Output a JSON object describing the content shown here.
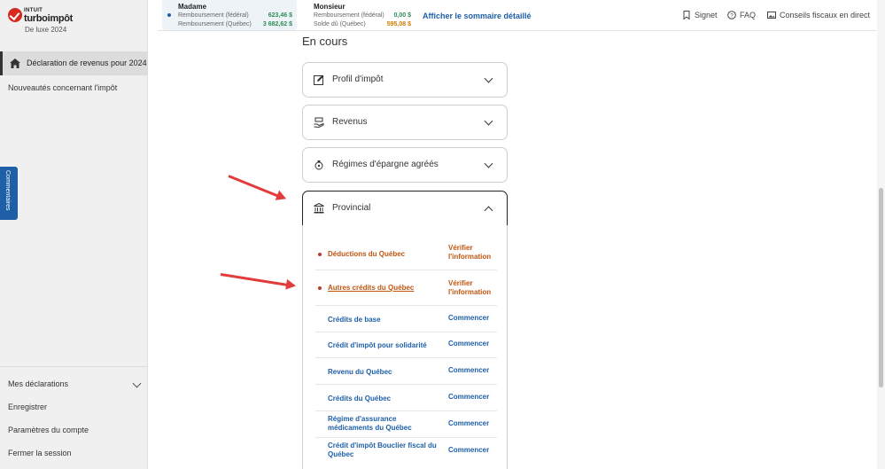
{
  "brand": {
    "intuit": "INTUIT",
    "name": "turboimpôt",
    "edition": "De luxe 2024"
  },
  "sidebar": {
    "active_item": "Déclaration de revenus pour 2024",
    "news_item": "Nouveautés concernant l'impôt",
    "comments_tab": "Commentaires",
    "bottom_items": [
      "Mes déclarations",
      "Enregistrer",
      "Paramètres du compte",
      "Fermer la session"
    ]
  },
  "topbar": {
    "madame": {
      "name": "Madame",
      "rows": [
        {
          "label": "Remboursement (fédéral)",
          "value": "623,46  $"
        },
        {
          "label": "Remboursement (Québec)",
          "value": "3  682,62  $"
        }
      ]
    },
    "monsieur": {
      "name": "Monsieur",
      "rows": [
        {
          "label": "Remboursement (fédéral)",
          "value": "0,00  $"
        },
        {
          "label": "Solde dû (Québec)",
          "value": "595,08  $"
        }
      ]
    },
    "summary_link": "Afficher le sommaire détaillé",
    "actions": [
      "Signet",
      "FAQ",
      "Conseils fiscaux en direct"
    ]
  },
  "main": {
    "section_title": "En cours",
    "accordions": [
      {
        "label": "Profil d'impôt",
        "icon": "edit-icon",
        "open": false
      },
      {
        "label": "Revenus",
        "icon": "money-hand-icon",
        "open": false
      },
      {
        "label": "Régimes d'épargne agréés",
        "icon": "piggy-bank-icon",
        "open": false
      },
      {
        "label": "Provincial",
        "icon": "government-building-icon",
        "open": true
      }
    ],
    "provincial_items": [
      {
        "name": "Déductions du Québec",
        "action": "Vérifier l'information",
        "alert": true
      },
      {
        "name": "Autres crédits du Québec",
        "action": "Vérifier l'information",
        "alert": true
      },
      {
        "name": "Crédits de base",
        "action": "Commencer",
        "alert": false
      },
      {
        "name": "Crédit d'impôt pour solidarité",
        "action": "Commencer",
        "alert": false
      },
      {
        "name": "Revenu du Québec",
        "action": "Commencer",
        "alert": false
      },
      {
        "name": "Crédits du Québec",
        "action": "Commencer",
        "alert": false
      },
      {
        "name": "Régime d'assurance médicaments du Québec",
        "action": "Commencer",
        "alert": false
      },
      {
        "name": "Crédit d'impôt Bouclier fiscal du Québec",
        "action": "Commencer",
        "alert": false
      }
    ]
  },
  "colors": {
    "brand_red": "#d52b1e",
    "link_blue": "#1e5fa8",
    "alert_orange": "#c0550f",
    "annotation_red": "#e23b3b"
  }
}
